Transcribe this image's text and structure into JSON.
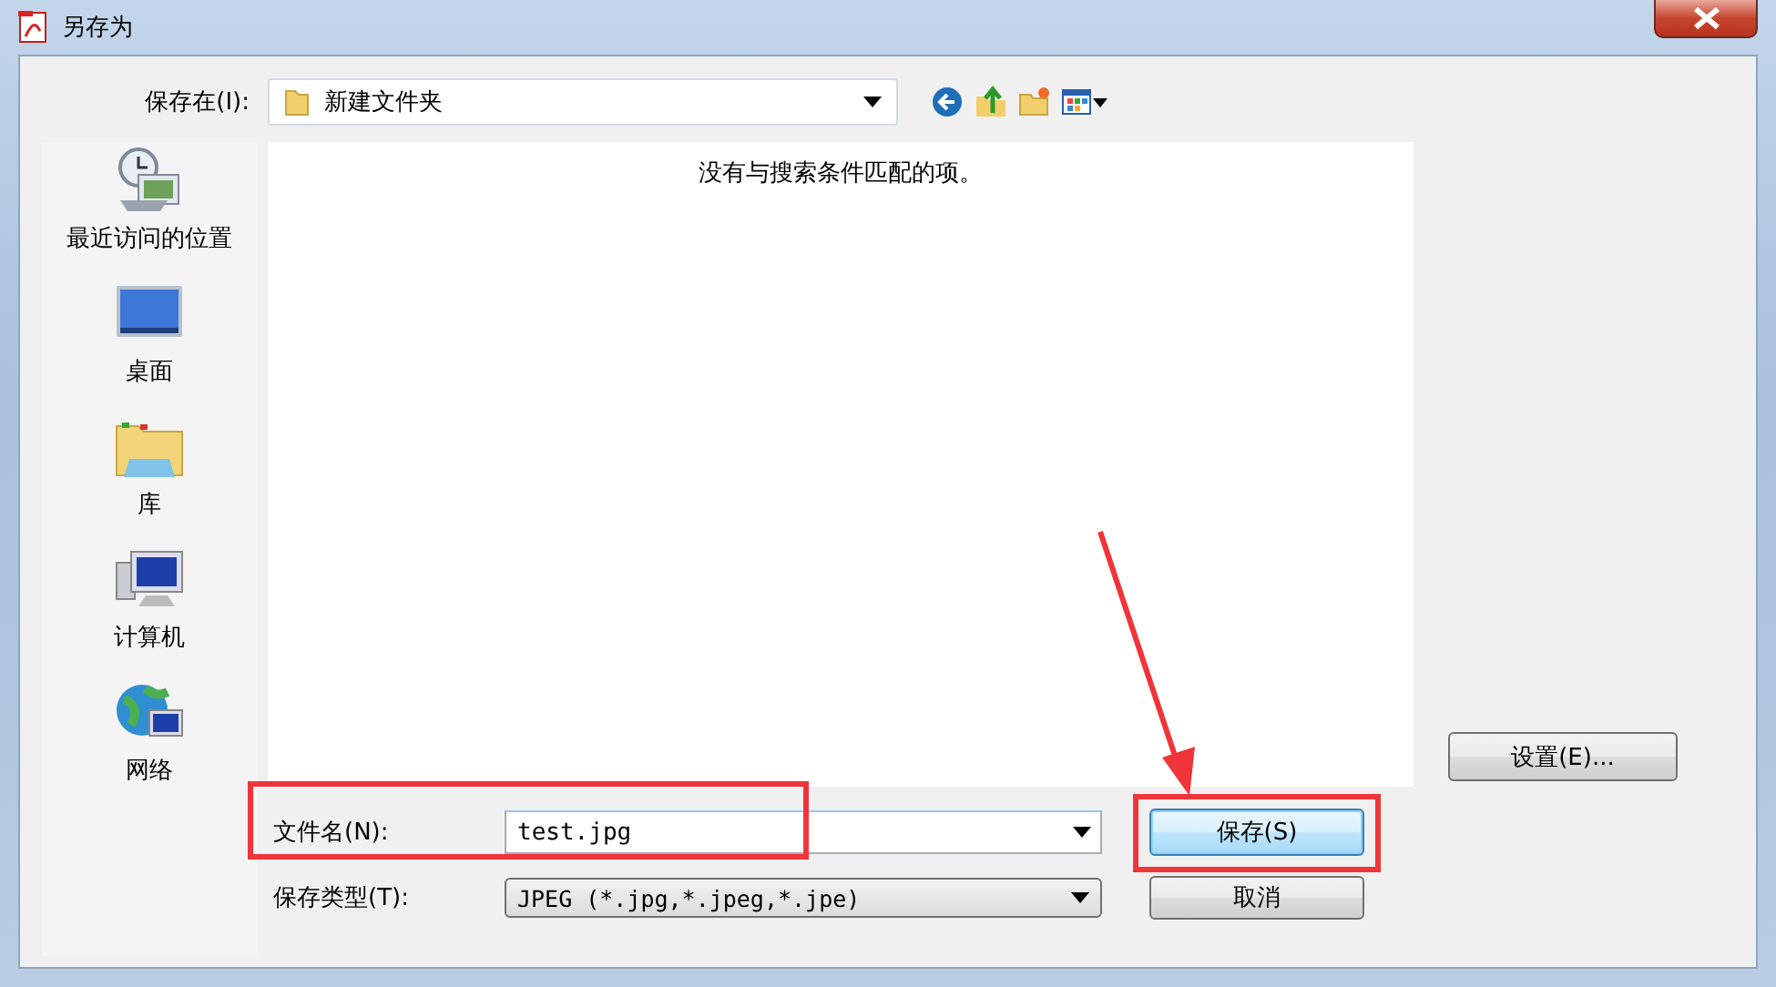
{
  "window": {
    "title": "另存为"
  },
  "save_in": {
    "label": "保存在(I):",
    "value": "新建文件夹"
  },
  "places": [
    {
      "label": "最近访问的位置",
      "kind": "recent"
    },
    {
      "label": "桌面",
      "kind": "desktop"
    },
    {
      "label": "库",
      "kind": "library"
    },
    {
      "label": "计算机",
      "kind": "computer"
    },
    {
      "label": "网络",
      "kind": "network"
    }
  ],
  "file_list": {
    "empty_message": "没有与搜索条件匹配的项。"
  },
  "settings_button": {
    "label": "设置(E)..."
  },
  "file_name": {
    "label": "文件名(N):",
    "value": "test.jpg"
  },
  "file_type": {
    "label": "保存类型(T):",
    "value": "JPEG (*.jpg,*.jpeg,*.jpe)"
  },
  "buttons": [
    {
      "label": "保存(S)",
      "kind": "default"
    },
    {
      "label": "取消",
      "kind": "normal"
    }
  ]
}
